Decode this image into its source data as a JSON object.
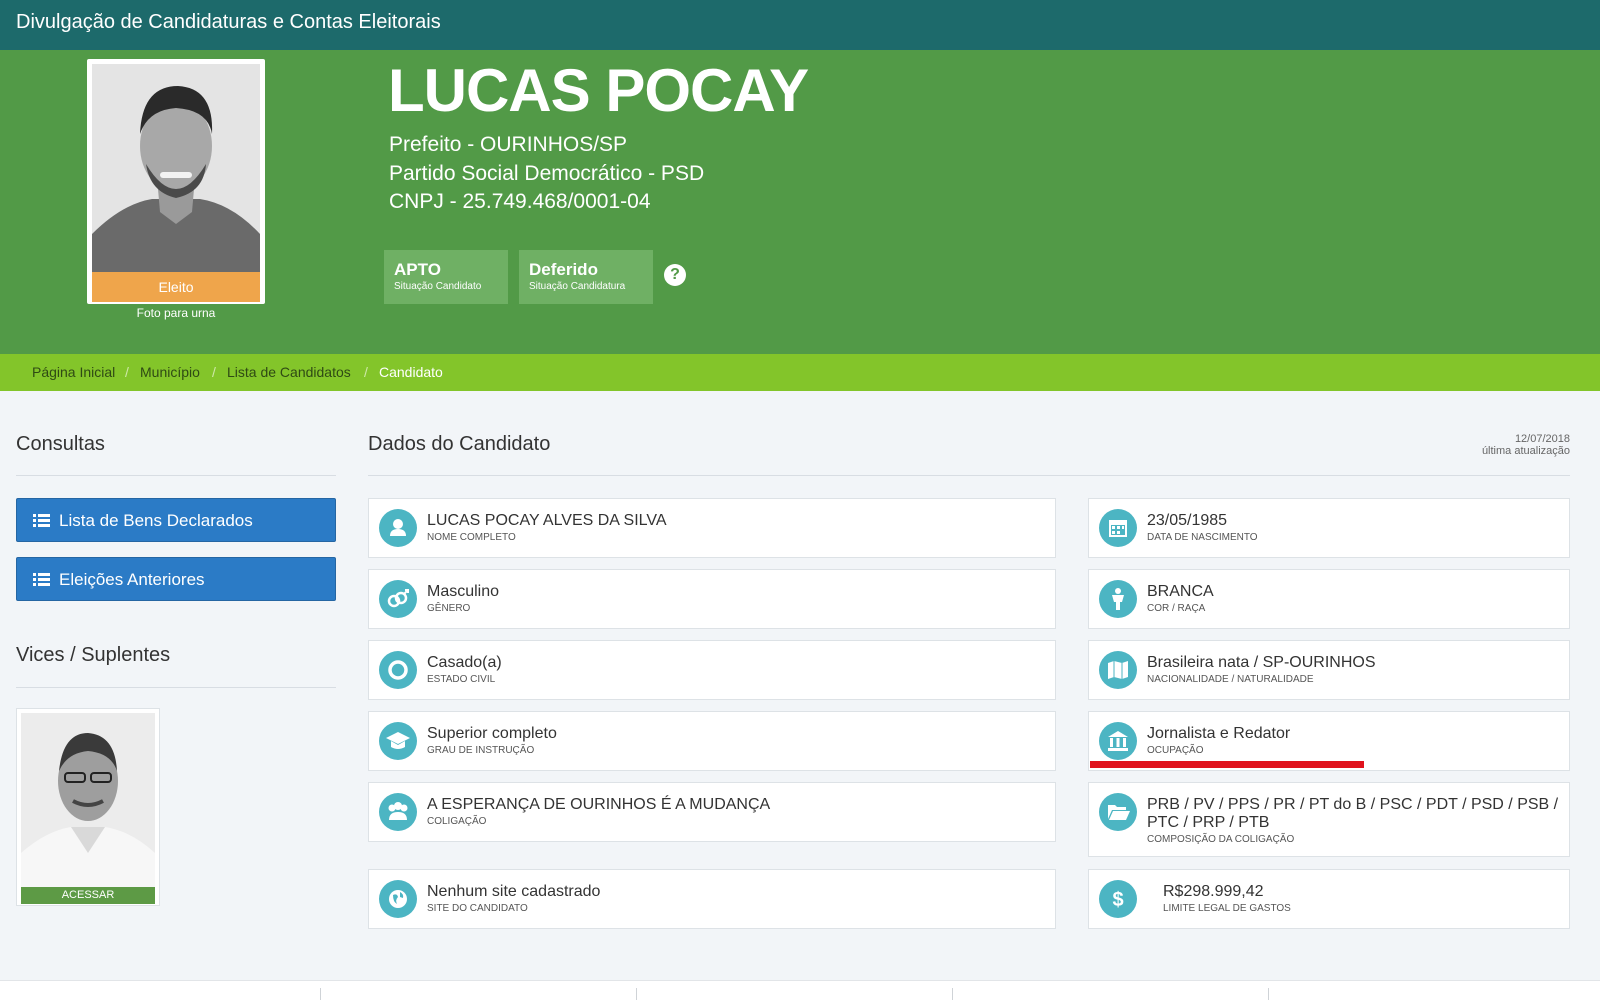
{
  "topbar": {
    "title": "Divulgação de Candidaturas e Contas Eleitorais"
  },
  "candidate": {
    "name": "LUCAS POCAY",
    "office": "Prefeito - OURINHOS/SP",
    "party": "Partido Social Democrático - PSD",
    "cnpj": "CNPJ - 25.749.468/0001-04",
    "photo_status": "Eleito",
    "photo_caption": "Foto para urna",
    "badges": [
      {
        "value": "APTO",
        "label": "Situação Candidato"
      },
      {
        "value": "Deferido",
        "label": "Situação Candidatura"
      }
    ],
    "help_icon": "?"
  },
  "breadcrumb": {
    "items": [
      "Página Inicial",
      "Município",
      "Lista de Candidatos",
      "Candidato"
    ],
    "separator": "/"
  },
  "sidebar": {
    "consultas_title": "Consultas",
    "buttons": [
      "Lista de Bens Declarados",
      "Eleições Anteriores"
    ],
    "vices_title": "Vices / Suplentes",
    "vice_button": "ACESSAR"
  },
  "main": {
    "title": "Dados do Candidato",
    "update_date": "12/07/2018",
    "update_label": "última atualização",
    "fields_left": [
      {
        "value": "LUCAS POCAY ALVES DA SILVA",
        "label": "NOME COMPLETO",
        "icon": "user-icon"
      },
      {
        "value": "Masculino",
        "label": "GÊNERO",
        "icon": "gender-icon"
      },
      {
        "value": "Casado(a)",
        "label": "ESTADO CIVIL",
        "icon": "ring-icon"
      },
      {
        "value": "Superior completo",
        "label": "GRAU DE INSTRUÇÃO",
        "icon": "graduation-cap-icon"
      },
      {
        "value": "A ESPERANÇA DE OURINHOS É A MUDANÇA",
        "label": "COLIGAÇÃO",
        "icon": "group-icon"
      },
      {
        "value": "Nenhum site cadastrado",
        "label": "SITE DO CANDIDATO",
        "icon": "globe-icon"
      }
    ],
    "fields_right": [
      {
        "value": "23/05/1985",
        "label": "DATA DE NASCIMENTO",
        "icon": "calendar-icon"
      },
      {
        "value": "BRANCA",
        "label": "COR / RAÇA",
        "icon": "person-icon"
      },
      {
        "value": "Brasileira nata / SP-OURINHOS",
        "label": "NACIONALIDADE / NATURALIDADE",
        "icon": "map-icon"
      },
      {
        "value": "Jornalista e Redator",
        "label": "OCUPAÇÃO",
        "icon": "institution-icon"
      },
      {
        "value": "PRB / PV / PPS / PR / PT do B / PSC / PDT / PSD / PSB /",
        "value2": "PTC / PRP / PTB",
        "label": "COMPOSIÇÃO DA COLIGAÇÃO",
        "icon": "folder-open-icon"
      },
      {
        "value": "R$298.999,42",
        "label": "LIMITE LEGAL DE GASTOS",
        "icon": "dollar-icon"
      }
    ]
  },
  "colors": {
    "topbar": "#1d6a6b",
    "hero": "#529a47",
    "breadcrumb": "#83c52a",
    "button": "#2b7bc6",
    "icon_circle": "#4cb5c3",
    "status_eleito": "#efa54b",
    "highlight": "#e0121c"
  }
}
